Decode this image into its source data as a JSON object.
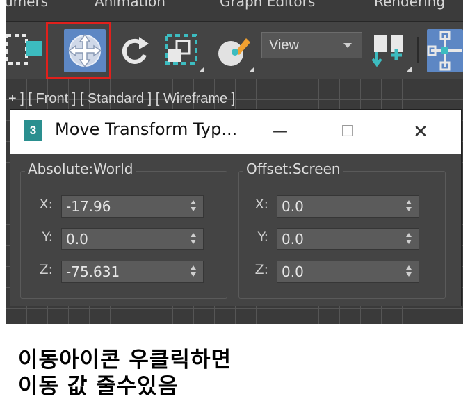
{
  "menu": {
    "items": [
      "umers",
      "Animation",
      "Graph Editors",
      "Rendering"
    ]
  },
  "toolbar": {
    "view_dropdown": "View",
    "icons": [
      "select-region-icon",
      "move-icon",
      "rotate-icon",
      "scale-icon",
      "material-editor-icon",
      "snap-icon",
      "use-pivot-icon"
    ],
    "accent": "#5d87c4",
    "highlight_color": "#e0201c"
  },
  "viewport": {
    "label": "+ ] [ Front ] [ Standard ] [ Wireframe ]"
  },
  "dialog": {
    "app_icon": "3",
    "title": "Move Transform Typ...",
    "minimize": "—",
    "maximize": "☐",
    "close": "✕",
    "absolute": {
      "label": "Absolute:World",
      "x": {
        "axis": "X:",
        "value": "-17.96"
      },
      "y": {
        "axis": "Y:",
        "value": "0.0"
      },
      "z": {
        "axis": "Z:",
        "value": "-75.631"
      }
    },
    "offset": {
      "label": "Offset:Screen",
      "x": {
        "axis": "X:",
        "value": "0.0"
      },
      "y": {
        "axis": "Y:",
        "value": "0.0"
      },
      "z": {
        "axis": "Z:",
        "value": "0.0"
      }
    }
  },
  "caption": {
    "line1": "이동아이콘 우클릭하면",
    "line2": "이동 값 줄수있음"
  }
}
